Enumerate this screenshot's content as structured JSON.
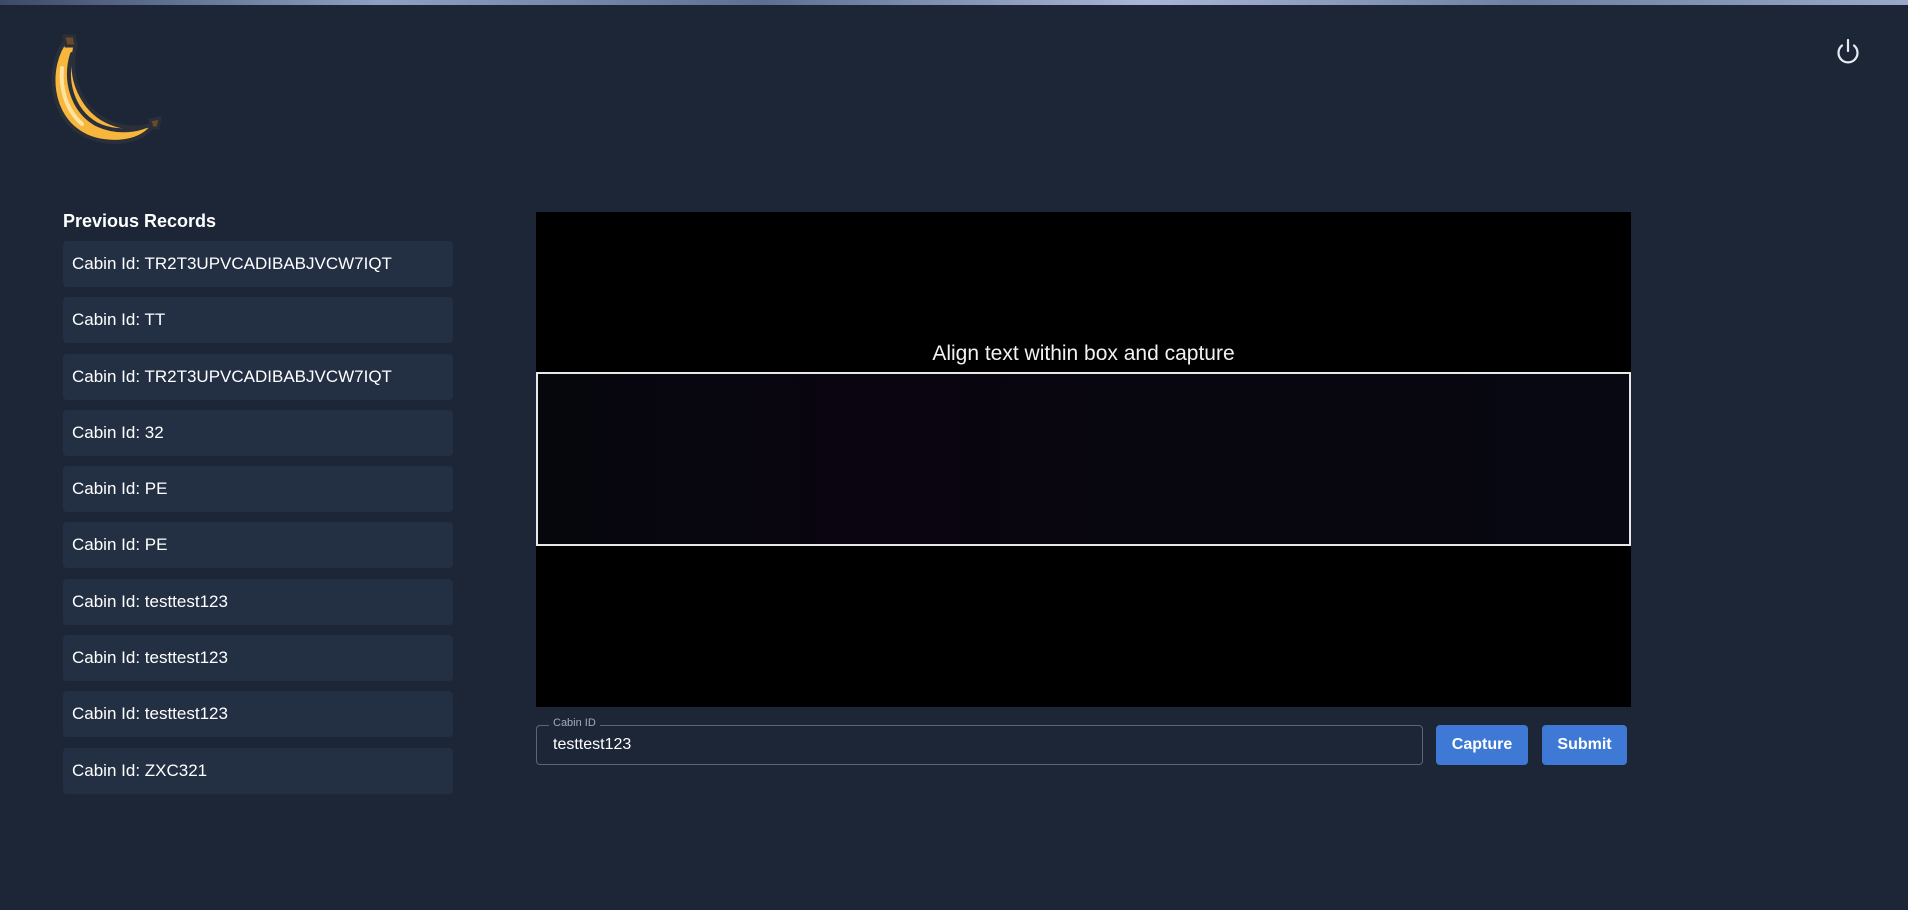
{
  "header": {
    "logo_icon": "banana-icon",
    "power_icon": "power-icon"
  },
  "records": {
    "title": "Previous Records",
    "items": [
      {
        "label": "Cabin Id: TR2T3UPVCADIBABJVCW7IQT"
      },
      {
        "label": "Cabin Id: TT"
      },
      {
        "label": "Cabin Id: TR2T3UPVCADIBABJVCW7IQT"
      },
      {
        "label": "Cabin Id: 32"
      },
      {
        "label": "Cabin Id: PE"
      },
      {
        "label": "Cabin Id: PE"
      },
      {
        "label": "Cabin Id: testtest123"
      },
      {
        "label": "Cabin Id: testtest123"
      },
      {
        "label": "Cabin Id: testtest123"
      },
      {
        "label": "Cabin Id: ZXC321"
      }
    ]
  },
  "camera": {
    "hint": "Align text within box and capture"
  },
  "form": {
    "cabin_label": "Cabin ID",
    "cabin_value": "testtest123",
    "capture_label": "Capture",
    "submit_label": "Submit"
  },
  "colors": {
    "background": "#1c2636",
    "record_item": "#232f43",
    "accent": "#3f79d6",
    "banana": "#f6b73c"
  }
}
